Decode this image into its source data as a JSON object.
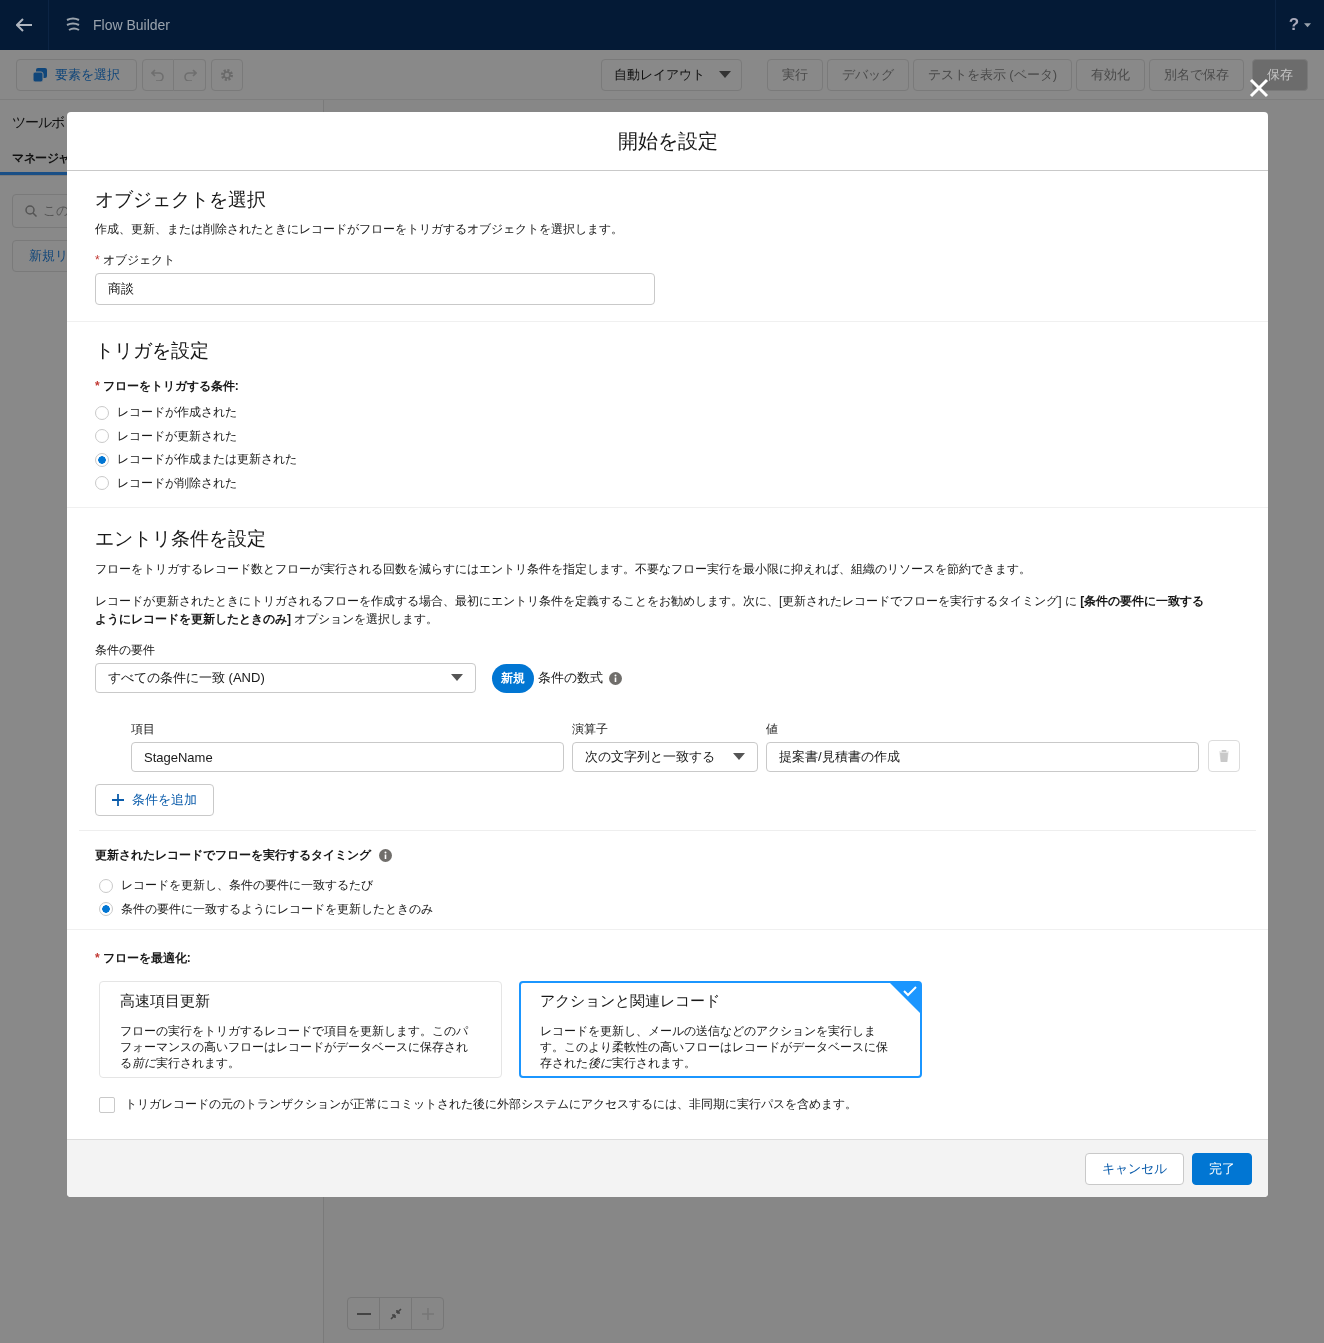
{
  "header": {
    "app_title": "Flow Builder",
    "help_label": "?"
  },
  "toolbar": {
    "select_button": "要素を選択",
    "layout_dropdown": "自動レイアウト",
    "actions": [
      {
        "label": "実行",
        "kind": "neutral",
        "disabled": true
      },
      {
        "label": "デバッグ",
        "kind": "neutral",
        "disabled": true
      },
      {
        "label": "テストを表示 (ベータ)",
        "kind": "neutral",
        "disabled": true
      },
      {
        "label": "有効化",
        "kind": "neutral",
        "disabled": true
      },
      {
        "label": "別名で保存",
        "kind": "neutral",
        "disabled": true
      },
      {
        "label": "保存",
        "kind": "primary",
        "disabled": true
      }
    ]
  },
  "sidebar": {
    "title": "ツールボ",
    "tabs": [
      {
        "label": "マネージャ",
        "selected": true
      }
    ],
    "search": {
      "placeholder": "この"
    },
    "new_button": "新規リ"
  },
  "modal": {
    "title": "開始を設定",
    "object_section": {
      "heading": "オブジェクトを選択",
      "description": "作成、更新、または削除されたときにレコードがフローをトリガするオブジェクトを選択します。",
      "field_label": "オブジェクト",
      "required_mark": "*",
      "value": "商談"
    },
    "trigger_section": {
      "heading": "トリガを設定",
      "label": "フローをトリガする条件:",
      "required_mark": "*",
      "options": [
        {
          "label": "レコードが作成された",
          "selected": false
        },
        {
          "label": "レコードが更新された",
          "selected": false
        },
        {
          "label": "レコードが作成または更新された",
          "selected": true
        },
        {
          "label": "レコードが削除された",
          "selected": false
        }
      ]
    },
    "entry_section": {
      "heading": "エントリ条件を設定",
      "paragraphs": [
        "フローをトリガするレコード数とフローが実行される回数を減らすにはエントリ条件を指定します。不要なフロー実行を最小限に抑えれば、組織のリソースを節約できます。",
        "レコードが更新されたときにトリガされるフローを作成する場合、最初にエントリ条件を定義することをお勧めします。次に、[更新されたレコードでフローを実行するタイミング] に **[条件の要件に一致するようにレコードを更新したときのみ]** オプションを選択します。"
      ],
      "requirement_label": "条件の要件",
      "requirement_value": "すべての条件に一致 (AND)",
      "new_badge": "新規",
      "formula_label": "条件の数式",
      "condition_columns": [
        "項目",
        "演算子",
        "値"
      ],
      "conditions": [
        {
          "field": "StageName",
          "operator": "次の文字列と一致する",
          "value": "提案書/見積書の作成"
        }
      ],
      "add_button": "条件を追加",
      "timing_label": "更新されたレコードでフローを実行するタイミング",
      "timing_options": [
        {
          "label": "レコードを更新し、条件の要件に一致するたび",
          "selected": false
        },
        {
          "label": "条件の要件に一致するようにレコードを更新したときのみ",
          "selected": true
        }
      ]
    },
    "optimize_section": {
      "label": "フローを最適化:",
      "required_mark": "*",
      "options": [
        {
          "title": "高速項目更新",
          "description": {
            "before": "フローの実行をトリガするレコードで項目を更新します。このパフォーマンスの高いフローはレコードがデータベースに保存される",
            "italic": "前に",
            "after": "実行されます。"
          },
          "selected": false
        },
        {
          "title": "アクションと関連レコード",
          "description": {
            "before": "レコードを更新し、メールの送信などのアクションを実行します。このより柔軟性の高いフローはレコードがデータベースに保存された",
            "italic": "後に",
            "after": "実行されます。"
          },
          "selected": true
        }
      ],
      "async_checkbox": {
        "label": "トリガレコードの元のトランザクションが正常にコミットされた後に外部システムにアクセスするには、非同期に実行パスを含めます。",
        "checked": false
      }
    },
    "footer": {
      "cancel": "キャンセル",
      "done": "完了"
    }
  }
}
